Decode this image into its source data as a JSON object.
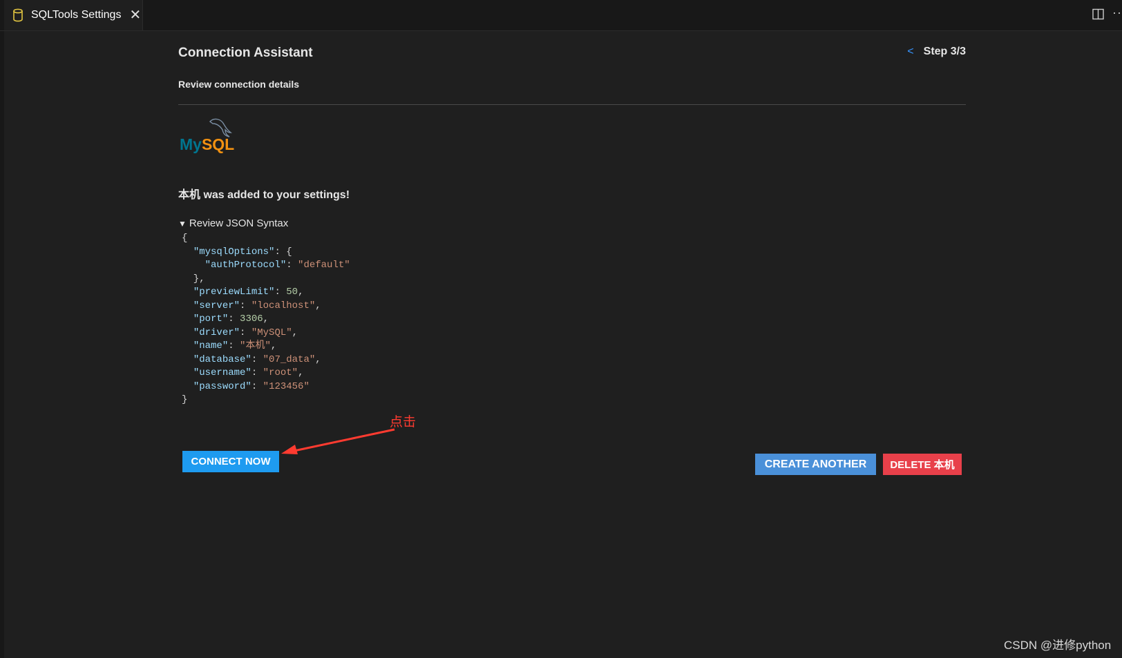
{
  "tab": {
    "title": "SQLTools Settings",
    "close_glyph": "✕",
    "icon": "database-icon"
  },
  "toolbar": {
    "split_icon": "split-editor-icon",
    "more_glyph": "···"
  },
  "header": {
    "title": "Connection Assistant",
    "back_glyph": "<",
    "step": "Step 3/3",
    "subtitle": "Review connection details"
  },
  "logo": {
    "my": "My",
    "sql": "SQL",
    "colors": {
      "my": "#00758f",
      "sql": "#f29111"
    }
  },
  "message": "本机 was added to your settings!",
  "review": {
    "summary": "Review JSON Syntax",
    "json_lines": [
      [
        [
          "p",
          "{"
        ]
      ],
      [
        [
          "p",
          "  "
        ],
        [
          "k",
          "\"mysqlOptions\""
        ],
        [
          "p",
          ": {"
        ]
      ],
      [
        [
          "p",
          "    "
        ],
        [
          "k",
          "\"authProtocol\""
        ],
        [
          "p",
          ": "
        ],
        [
          "s",
          "\"default\""
        ]
      ],
      [
        [
          "p",
          "  },"
        ]
      ],
      [
        [
          "p",
          "  "
        ],
        [
          "k",
          "\"previewLimit\""
        ],
        [
          "p",
          ": "
        ],
        [
          "n",
          "50"
        ],
        [
          "p",
          ","
        ]
      ],
      [
        [
          "p",
          "  "
        ],
        [
          "k",
          "\"server\""
        ],
        [
          "p",
          ": "
        ],
        [
          "s",
          "\"localhost\""
        ],
        [
          "p",
          ","
        ]
      ],
      [
        [
          "p",
          "  "
        ],
        [
          "k",
          "\"port\""
        ],
        [
          "p",
          ": "
        ],
        [
          "n",
          "3306"
        ],
        [
          "p",
          ","
        ]
      ],
      [
        [
          "p",
          "  "
        ],
        [
          "k",
          "\"driver\""
        ],
        [
          "p",
          ": "
        ],
        [
          "s",
          "\"MySQL\""
        ],
        [
          "p",
          ","
        ]
      ],
      [
        [
          "p",
          "  "
        ],
        [
          "k",
          "\"name\""
        ],
        [
          "p",
          ": "
        ],
        [
          "s",
          "\"本机\""
        ],
        [
          "p",
          ","
        ]
      ],
      [
        [
          "p",
          "  "
        ],
        [
          "k",
          "\"database\""
        ],
        [
          "p",
          ": "
        ],
        [
          "s",
          "\"07_data\""
        ],
        [
          "p",
          ","
        ]
      ],
      [
        [
          "p",
          "  "
        ],
        [
          "k",
          "\"username\""
        ],
        [
          "p",
          ": "
        ],
        [
          "s",
          "\"root\""
        ],
        [
          "p",
          ","
        ]
      ],
      [
        [
          "p",
          "  "
        ],
        [
          "k",
          "\"password\""
        ],
        [
          "p",
          ": "
        ],
        [
          "s",
          "\"123456\""
        ]
      ],
      [
        [
          "p",
          "}"
        ]
      ]
    ]
  },
  "annotation": "点击",
  "buttons": {
    "connect": "CONNECT NOW",
    "create": "CREATE ANOTHER",
    "delete": "DELETE 本机"
  },
  "watermark": "CSDN @进修python",
  "colors": {
    "background": "#1f1f1f",
    "connect_button": "#1e9bf0",
    "create_button": "#4a90d9",
    "delete_button": "#e8404a",
    "annotation": "#ff3b30",
    "accent_link": "#3794ff"
  }
}
